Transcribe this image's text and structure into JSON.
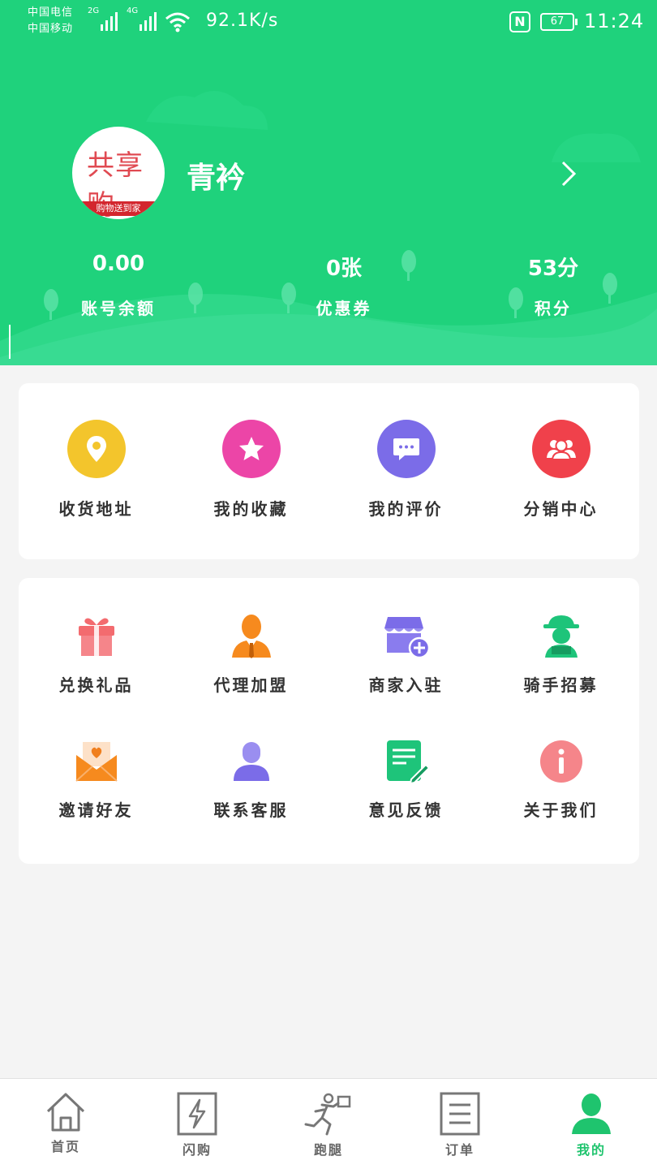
{
  "status_bar": {
    "carrier_1": "中国电信",
    "carrier_2": "中国移动",
    "net_1": "2G",
    "net_2": "4G",
    "speed": "92.1K/s",
    "nfc": "N",
    "battery": "67",
    "time": "11:24"
  },
  "profile": {
    "username": "青衿",
    "avatar_text": "共享购",
    "avatar_ribbon": "购物送到家",
    "stats": [
      {
        "value": "0.00",
        "label": "账号余额"
      },
      {
        "value": "0张",
        "label": "优惠券"
      },
      {
        "value": "53分",
        "label": "积分"
      }
    ]
  },
  "quick_actions": [
    {
      "label": "收货地址",
      "icon": "location-pin-icon",
      "color": "#f3c52c"
    },
    {
      "label": "我的收藏",
      "icon": "star-icon",
      "color": "#ec45a7"
    },
    {
      "label": "我的评价",
      "icon": "chat-bubble-icon",
      "color": "#7b6ce8"
    },
    {
      "label": "分销中心",
      "icon": "users-icon",
      "color": "#f0414b"
    }
  ],
  "services": [
    {
      "label": "兑换礼品",
      "icon": "gift-icon"
    },
    {
      "label": "代理加盟",
      "icon": "agent-icon"
    },
    {
      "label": "商家入驻",
      "icon": "store-add-icon"
    },
    {
      "label": "骑手招募",
      "icon": "rider-icon"
    },
    {
      "label": "邀请好友",
      "icon": "envelope-heart-icon"
    },
    {
      "label": "联系客服",
      "icon": "person-icon"
    },
    {
      "label": "意见反馈",
      "icon": "feedback-edit-icon"
    },
    {
      "label": "关于我们",
      "icon": "info-icon"
    }
  ],
  "tabbar": [
    {
      "label": "首页",
      "icon": "home-icon"
    },
    {
      "label": "闪购",
      "icon": "flash-icon"
    },
    {
      "label": "跑腿",
      "icon": "runner-icon"
    },
    {
      "label": "订单",
      "icon": "order-icon"
    },
    {
      "label": "我的",
      "icon": "profile-icon",
      "active": true
    }
  ],
  "colors": {
    "brand_green": "#1fd27c",
    "active_tab": "#1fc46e"
  }
}
